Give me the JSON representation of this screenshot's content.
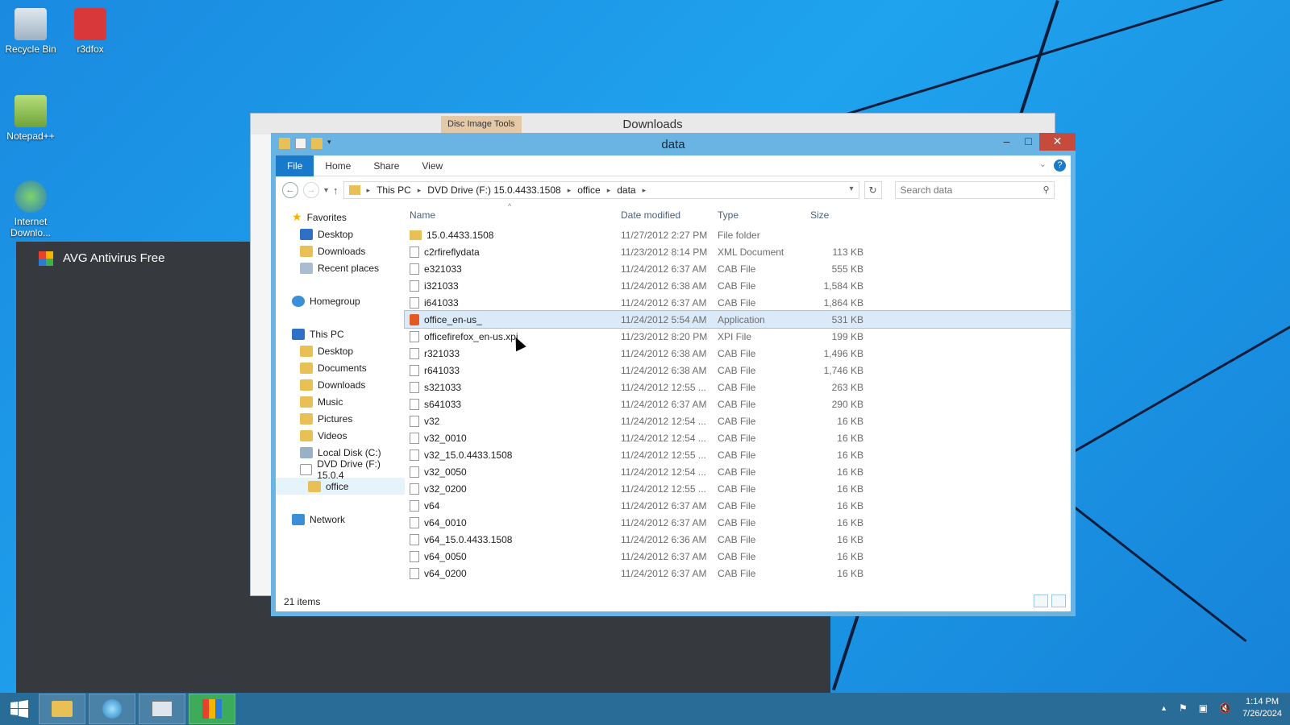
{
  "desktop": {
    "icons": [
      {
        "label": "Recycle Bin"
      },
      {
        "label": "r3dfox"
      },
      {
        "label": "Notepad++"
      },
      {
        "label": "Internet Downlo..."
      }
    ]
  },
  "avg": {
    "title": "AVG Antivirus Free"
  },
  "downloads_window": {
    "title": "Downloads",
    "context_tab": "Disc Image Tools"
  },
  "window": {
    "title": "data",
    "ribbon_tabs": [
      "File",
      "Home",
      "Share",
      "View"
    ],
    "breadcrumb": [
      "This PC",
      "DVD Drive (F:) 15.0.4433.1508",
      "office",
      "data"
    ],
    "search_placeholder": "Search data",
    "nav": {
      "favorites": "Favorites",
      "favorites_items": [
        "Desktop",
        "Downloads",
        "Recent places"
      ],
      "homegroup": "Homegroup",
      "this_pc": "This PC",
      "this_pc_items": [
        "Desktop",
        "Documents",
        "Downloads",
        "Music",
        "Pictures",
        "Videos",
        "Local Disk (C:)",
        "DVD Drive (F:) 15.0.4"
      ],
      "office": "office",
      "network": "Network"
    },
    "columns": {
      "name": "Name",
      "date": "Date modified",
      "type": "Type",
      "size": "Size"
    },
    "files": [
      {
        "name": "15.0.4433.1508",
        "date": "11/27/2012 2:27 PM",
        "type": "File folder",
        "size": "",
        "icon": "folder-icon"
      },
      {
        "name": "c2rfireflydata",
        "date": "11/23/2012 8:14 PM",
        "type": "XML Document",
        "size": "113 KB",
        "icon": "file-icon"
      },
      {
        "name": "e321033",
        "date": "11/24/2012 6:37 AM",
        "type": "CAB File",
        "size": "555 KB",
        "icon": "file-icon"
      },
      {
        "name": "i321033",
        "date": "11/24/2012 6:38 AM",
        "type": "CAB File",
        "size": "1,584 KB",
        "icon": "file-icon"
      },
      {
        "name": "i641033",
        "date": "11/24/2012 6:37 AM",
        "type": "CAB File",
        "size": "1,864 KB",
        "icon": "file-icon"
      },
      {
        "name": "office_en-us_",
        "date": "11/24/2012 5:54 AM",
        "type": "Application",
        "size": "531 KB",
        "icon": "office-app-icon",
        "selected": true
      },
      {
        "name": "officefirefox_en-us.xpi",
        "date": "11/23/2012 8:20 PM",
        "type": "XPI File",
        "size": "199 KB",
        "icon": "file-icon"
      },
      {
        "name": "r321033",
        "date": "11/24/2012 6:38 AM",
        "type": "CAB File",
        "size": "1,496 KB",
        "icon": "file-icon"
      },
      {
        "name": "r641033",
        "date": "11/24/2012 6:38 AM",
        "type": "CAB File",
        "size": "1,746 KB",
        "icon": "file-icon"
      },
      {
        "name": "s321033",
        "date": "11/24/2012 12:55 ...",
        "type": "CAB File",
        "size": "263 KB",
        "icon": "file-icon"
      },
      {
        "name": "s641033",
        "date": "11/24/2012 6:37 AM",
        "type": "CAB File",
        "size": "290 KB",
        "icon": "file-icon"
      },
      {
        "name": "v32",
        "date": "11/24/2012 12:54 ...",
        "type": "CAB File",
        "size": "16 KB",
        "icon": "file-icon"
      },
      {
        "name": "v32_0010",
        "date": "11/24/2012 12:54 ...",
        "type": "CAB File",
        "size": "16 KB",
        "icon": "file-icon"
      },
      {
        "name": "v32_15.0.4433.1508",
        "date": "11/24/2012 12:55 ...",
        "type": "CAB File",
        "size": "16 KB",
        "icon": "file-icon"
      },
      {
        "name": "v32_0050",
        "date": "11/24/2012 12:54 ...",
        "type": "CAB File",
        "size": "16 KB",
        "icon": "file-icon"
      },
      {
        "name": "v32_0200",
        "date": "11/24/2012 12:55 ...",
        "type": "CAB File",
        "size": "16 KB",
        "icon": "file-icon"
      },
      {
        "name": "v64",
        "date": "11/24/2012 6:37 AM",
        "type": "CAB File",
        "size": "16 KB",
        "icon": "file-icon"
      },
      {
        "name": "v64_0010",
        "date": "11/24/2012 6:37 AM",
        "type": "CAB File",
        "size": "16 KB",
        "icon": "file-icon"
      },
      {
        "name": "v64_15.0.4433.1508",
        "date": "11/24/2012 6:36 AM",
        "type": "CAB File",
        "size": "16 KB",
        "icon": "file-icon"
      },
      {
        "name": "v64_0050",
        "date": "11/24/2012 6:37 AM",
        "type": "CAB File",
        "size": "16 KB",
        "icon": "file-icon"
      },
      {
        "name": "v64_0200",
        "date": "11/24/2012 6:37 AM",
        "type": "CAB File",
        "size": "16 KB",
        "icon": "file-icon"
      }
    ],
    "status": "21 items"
  },
  "taskbar": {
    "time": "1:14 PM",
    "date": "7/26/2024"
  },
  "colors": {
    "accent": "#1979ca",
    "titlebar": "#6ab4e3",
    "close": "#c74b3d",
    "taskbar": "#2a6c98"
  }
}
